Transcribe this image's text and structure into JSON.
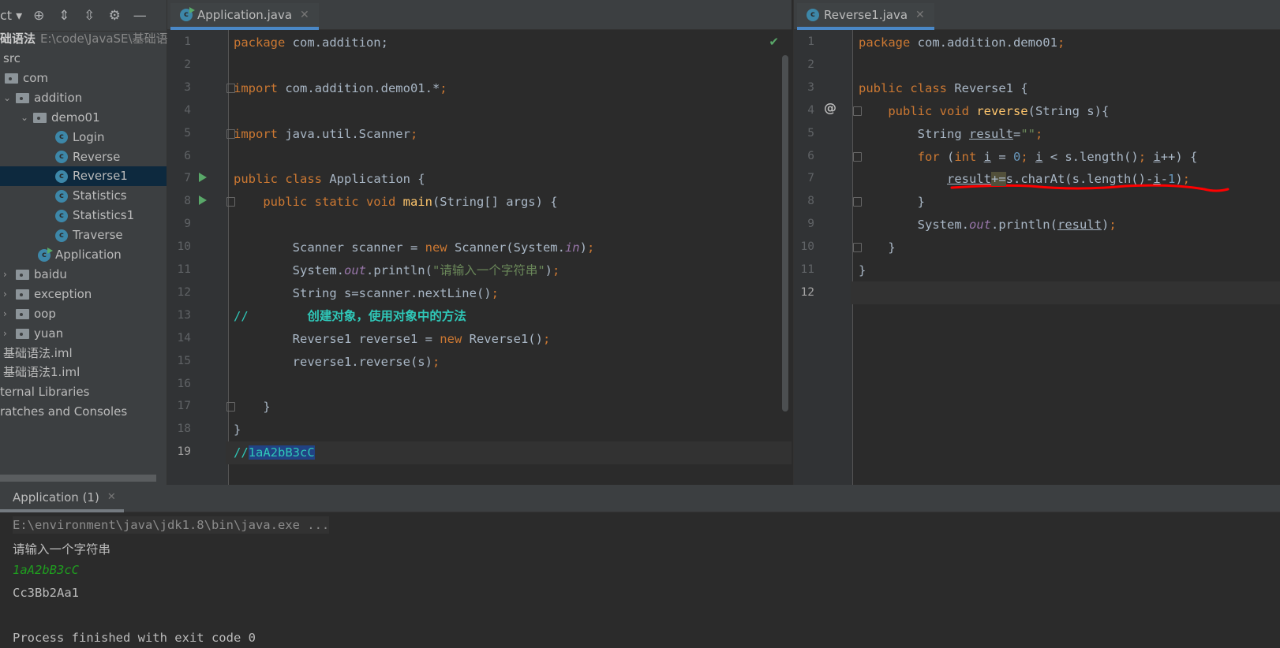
{
  "sidebar": {
    "title": "ct",
    "toolbar_icons": [
      "locate-icon",
      "expand-all-icon",
      "collapse-all-icon",
      "gear-icon",
      "minimize-icon"
    ],
    "project_name": "础语法",
    "project_path": "E:\\code\\JavaSE\\基础语法",
    "items": [
      {
        "label": "src",
        "type": "text",
        "indent": 0
      },
      {
        "label": "com",
        "type": "folder",
        "indent": 0
      },
      {
        "label": "addition",
        "type": "folder",
        "indent": 1,
        "expanded": true
      },
      {
        "label": "demo01",
        "type": "folder",
        "indent": 2,
        "expanded": true
      },
      {
        "label": "Login",
        "type": "class",
        "indent": 3
      },
      {
        "label": "Reverse",
        "type": "class",
        "indent": 3
      },
      {
        "label": "Reverse1",
        "type": "class",
        "indent": 3,
        "selected": true
      },
      {
        "label": "Statistics",
        "type": "class",
        "indent": 3
      },
      {
        "label": "Statistics1",
        "type": "class",
        "indent": 3
      },
      {
        "label": "Traverse",
        "type": "class",
        "indent": 3
      },
      {
        "label": "Application",
        "type": "runclass",
        "indent": 2
      },
      {
        "label": "baidu",
        "type": "folder",
        "indent": 1,
        "collapsed": true
      },
      {
        "label": "exception",
        "type": "folder",
        "indent": 1,
        "collapsed": true
      },
      {
        "label": "oop",
        "type": "folder",
        "indent": 1,
        "collapsed": true
      },
      {
        "label": "yuan",
        "type": "folder",
        "indent": 1,
        "collapsed": true
      },
      {
        "label": "基础语法.iml",
        "type": "text",
        "indent": 0
      },
      {
        "label": "基础语法1.iml",
        "type": "text",
        "indent": 0
      },
      {
        "label": "ternal Libraries",
        "type": "text",
        "indent": -1
      },
      {
        "label": "ratches and Consoles",
        "type": "text",
        "indent": -1
      }
    ]
  },
  "left_editor": {
    "tab": "Application.java",
    "current_line": 19,
    "lines": [
      [
        [
          "k",
          "package "
        ],
        [
          "t",
          "com.addition;"
        ]
      ],
      [],
      [
        [
          "k",
          "import "
        ],
        [
          "t",
          "com.addition.demo01.*"
        ],
        [
          "k",
          ";"
        ]
      ],
      [],
      [
        [
          "k",
          "import "
        ],
        [
          "t",
          "java.util.Scanner"
        ],
        [
          "k",
          ";"
        ]
      ],
      [],
      [
        [
          "k",
          "public class "
        ],
        [
          "t",
          "Application {"
        ]
      ],
      [
        [
          "t",
          "    "
        ],
        [
          "k",
          "public static void "
        ],
        [
          "m",
          "main"
        ],
        [
          "t",
          "(String[] args) {"
        ]
      ],
      [],
      [
        [
          "t",
          "        Scanner scanner = "
        ],
        [
          "k",
          "new "
        ],
        [
          "t",
          "Scanner(System."
        ],
        [
          "f",
          "in"
        ],
        [
          "t",
          ")"
        ],
        [
          "k",
          ";"
        ]
      ],
      [
        [
          "t",
          "        System."
        ],
        [
          "f",
          "out"
        ],
        [
          "t",
          ".println("
        ],
        [
          "s",
          "\"请输入一个字符串\""
        ],
        [
          "t",
          ")"
        ],
        [
          "k",
          ";"
        ]
      ],
      [
        [
          "t",
          "        String s=scanner.nextLine()"
        ],
        [
          "k",
          ";"
        ]
      ],
      [
        [
          "c",
          "//        "
        ],
        [
          "cb",
          "创建对象，使用对象中的方法"
        ]
      ],
      [
        [
          "t",
          "        Reverse1 reverse1 = "
        ],
        [
          "k",
          "new "
        ],
        [
          "t",
          "Reverse1()"
        ],
        [
          "k",
          ";"
        ]
      ],
      [
        [
          "t",
          "        reverse1.reverse(s)"
        ],
        [
          "k",
          ";"
        ]
      ],
      [],
      [
        [
          "t",
          "    }"
        ]
      ],
      [
        [
          "t",
          "}"
        ]
      ],
      [
        [
          "c",
          "//"
        ],
        [
          "c hl",
          "1aA2bB3cC"
        ]
      ]
    ]
  },
  "right_editor": {
    "tab": "Reverse1.java",
    "current_line": 12,
    "lines": [
      [
        [
          "k",
          "package "
        ],
        [
          "t",
          "com.addition.demo01"
        ],
        [
          "k",
          ";"
        ]
      ],
      [],
      [
        [
          "k",
          "public class "
        ],
        [
          "t",
          "Reverse1 {"
        ]
      ],
      [
        [
          "t",
          "    "
        ],
        [
          "k",
          "public void "
        ],
        [
          "m",
          "reverse"
        ],
        [
          "t",
          "(String s){"
        ]
      ],
      [
        [
          "t",
          "        String "
        ],
        [
          "t u",
          "result"
        ],
        [
          "t",
          "="
        ],
        [
          "s",
          "\"\""
        ],
        [
          "k",
          ";"
        ]
      ],
      [
        [
          "t",
          "        "
        ],
        [
          "k",
          "for "
        ],
        [
          "t",
          "("
        ],
        [
          "k",
          "int "
        ],
        [
          "t u",
          "i"
        ],
        [
          "t",
          " = "
        ],
        [
          "n",
          "0"
        ],
        [
          "k",
          "; "
        ],
        [
          "t u",
          "i"
        ],
        [
          "t",
          " < s.length()"
        ],
        [
          "k",
          "; "
        ],
        [
          "t u",
          "i"
        ],
        [
          "t",
          "++) {"
        ]
      ],
      [
        [
          "t",
          "            "
        ],
        [
          "t u",
          "result"
        ],
        [
          "t hb",
          "+="
        ],
        [
          "t",
          "s.charAt(s.length()-"
        ],
        [
          "t u",
          "i"
        ],
        [
          "t",
          "-"
        ],
        [
          "n",
          "1"
        ],
        [
          "t",
          ")"
        ],
        [
          "k",
          ";"
        ]
      ],
      [
        [
          "t",
          "        }"
        ]
      ],
      [
        [
          "t",
          "        System."
        ],
        [
          "f",
          "out"
        ],
        [
          "t",
          ".println("
        ],
        [
          "t u",
          "result"
        ],
        [
          "t",
          ")"
        ],
        [
          "k",
          ";"
        ]
      ],
      [
        [
          "t",
          "    }"
        ]
      ],
      [
        [
          "t",
          "}"
        ]
      ],
      []
    ]
  },
  "console": {
    "tab": "Application (1)",
    "command": "E:\\environment\\java\\jdk1.8\\bin\\java.exe ...",
    "prompt": "请输入一个字符串",
    "input": "1aA2bB3cC",
    "output": "Cc3Bb2Aa1",
    "exit": "Process finished with exit code 0"
  },
  "colors": {
    "keyword": "#cc7832",
    "string": "#6a8759",
    "comment": "#2fc7b8",
    "annotation_underline": "#ff0000",
    "selection": "#0d293e"
  }
}
